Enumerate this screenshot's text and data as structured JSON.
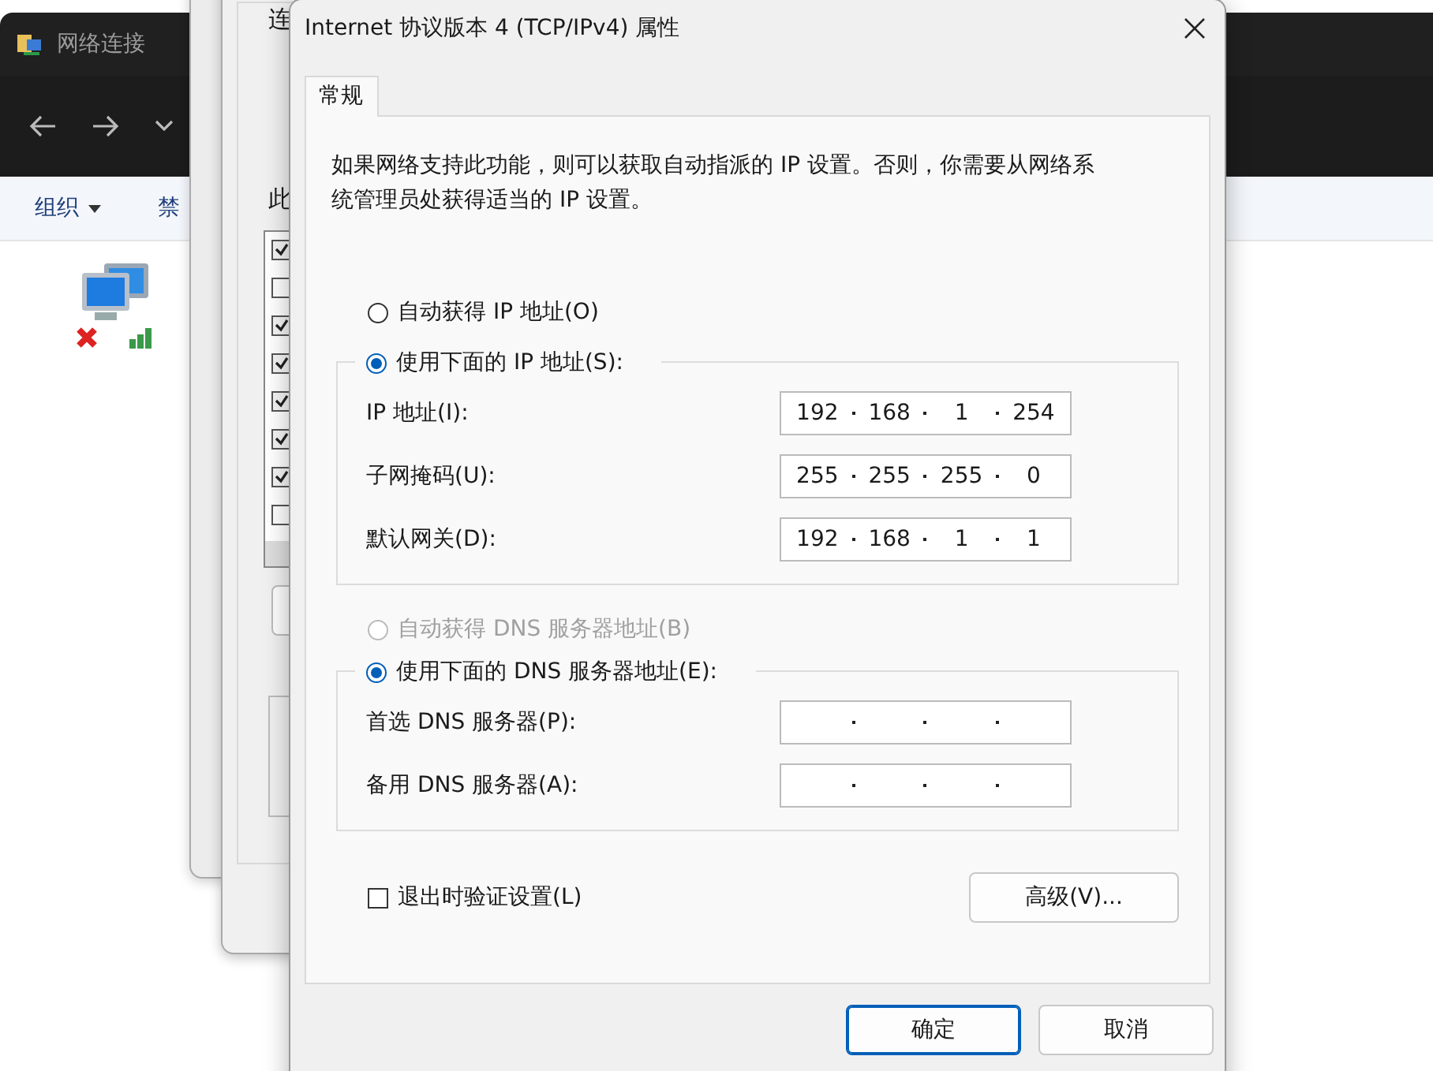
{
  "explorer": {
    "title": "网络连接",
    "toolbar": [
      "组织",
      "禁"
    ]
  },
  "back_dialog": {
    "heading": "连",
    "list_label": "此",
    "components": [
      {
        "checked": true
      },
      {
        "checked": false
      },
      {
        "checked": true
      },
      {
        "checked": true
      },
      {
        "checked": true
      },
      {
        "checked": true
      },
      {
        "checked": true
      },
      {
        "checked": false
      }
    ]
  },
  "dialog": {
    "title": "Internet 协议版本 4 (TCP/IPv4) 属性",
    "tabs": [
      {
        "label": "常规",
        "selected": true
      }
    ],
    "description": "如果网络支持此功能，则可以获取自动指派的 IP 设置。否则，你需要从网络系统管理员处获得适当的 IP 设置。",
    "ip_auto": {
      "label": "自动获得 IP 地址(O)",
      "selected": false,
      "disabled": false
    },
    "ip_manual": {
      "label": "使用下面的 IP 地址(S):",
      "selected": true,
      "disabled": false
    },
    "ip_fields": [
      {
        "label": "IP 地址(I):",
        "octets": [
          "192",
          "168",
          "1",
          "254"
        ]
      },
      {
        "label": "子网掩码(U):",
        "octets": [
          "255",
          "255",
          "255",
          "0"
        ]
      },
      {
        "label": "默认网关(D):",
        "octets": [
          "192",
          "168",
          "1",
          "1"
        ]
      }
    ],
    "dns_auto": {
      "label": "自动获得 DNS 服务器地址(B)",
      "selected": false,
      "disabled": true
    },
    "dns_manual": {
      "label": "使用下面的 DNS 服务器地址(E):",
      "selected": true,
      "disabled": false
    },
    "dns_fields": [
      {
        "label": "首选 DNS 服务器(P):"
      },
      {
        "label": "备用 DNS 服务器(A):"
      }
    ],
    "validate": {
      "label": "退出时验证设置(L)",
      "checked": false
    },
    "advanced": "高级(V)...",
    "buttons": [
      {
        "label": "确定",
        "default": true
      },
      {
        "label": "取消",
        "default": false
      }
    ]
  }
}
